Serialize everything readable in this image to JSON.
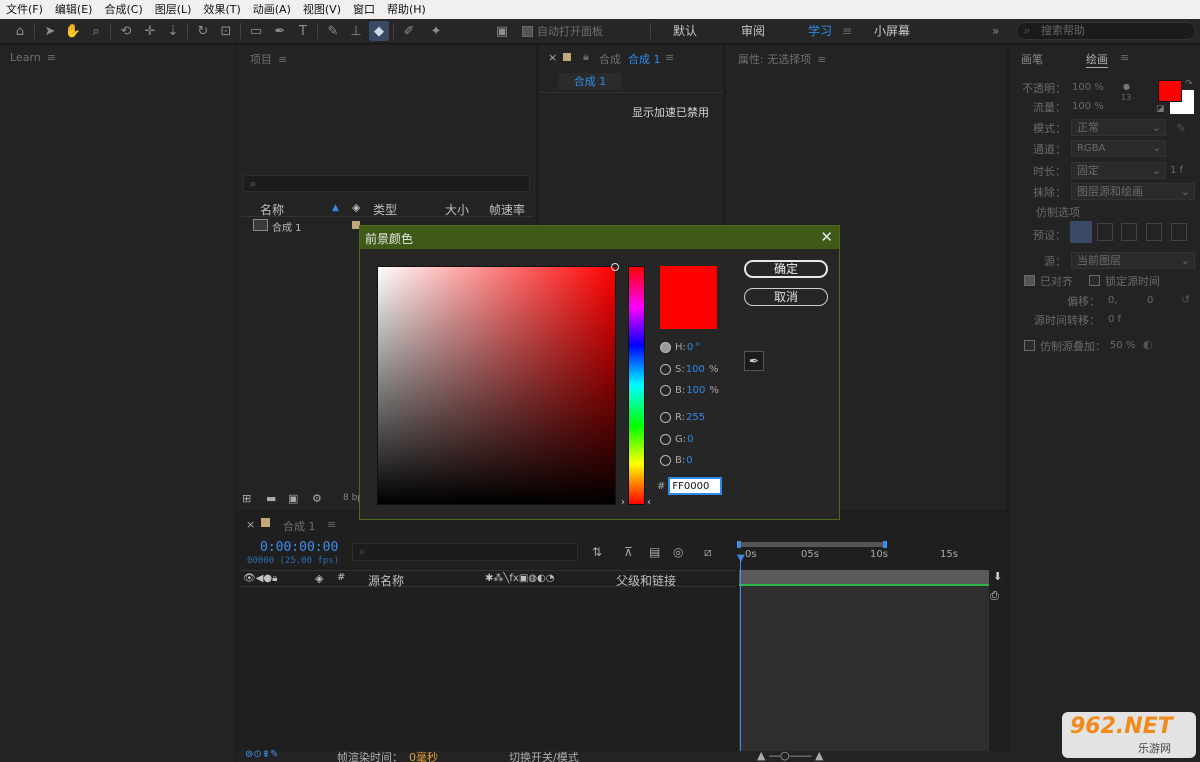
{
  "menu": [
    "文件(F)",
    "编辑(E)",
    "合成(C)",
    "图层(L)",
    "效果(T)",
    "动画(A)",
    "视图(V)",
    "窗口",
    "帮助(H)"
  ],
  "toolbar": {
    "auto_open": "自动打开面板",
    "workspaces": [
      "默认",
      "审阅",
      "学习",
      "小屏幕"
    ],
    "active_workspace": "学习",
    "overflow": "»",
    "search_placeholder": "搜索帮助"
  },
  "learn_panel": {
    "title": "Learn"
  },
  "project_panel": {
    "title": "项目",
    "search_icon": "⌕",
    "columns": [
      "名称",
      "类型",
      "大小",
      "帧速率"
    ],
    "item": {
      "name": "合成 1"
    },
    "bottom_bits": "8 bp"
  },
  "comp_panel": {
    "title": "合成",
    "comp_name": "合成 1",
    "tab_label": "合成 1",
    "message": "显示加速已禁用"
  },
  "properties_panel": {
    "title": "属性: 无选择项"
  },
  "paint_panel": {
    "tabs": [
      "画笔",
      "绘画"
    ],
    "opacity_label": "不透明：",
    "opacity_value": "100 %",
    "flow_label": "流量：",
    "flow_value": "100 %",
    "brush_size": "13",
    "mode_label": "模式：",
    "mode_value": "正常",
    "channels_label": "通道：",
    "channels_value": "RGBA",
    "duration_label": "时长：",
    "duration_value": "固定",
    "duration_frames": "1 f",
    "erase_label": "抹除：",
    "erase_value": "图层源和绘画",
    "clone_options": "仿制选项",
    "preset_label": "预设：",
    "source_label": "源：",
    "source_value": "当前图层",
    "aligned": "已对齐",
    "lock_source_time": "锁定源时间",
    "offset_label": "偏移：",
    "offset_x": "0,",
    "offset_y": "0",
    "source_time_shift_label": "源时间转移：",
    "source_time_shift_value": "0 f",
    "clone_overlay": "仿制源叠加：",
    "clone_overlay_value": "50 %",
    "foreground_color": "#ff0000",
    "background_color": "#ffffff"
  },
  "dialog": {
    "title": "前景颜色",
    "ok": "确定",
    "cancel": "取消",
    "h_label": "H:",
    "h_value": "0",
    "h_unit": "°",
    "s_label": "S:",
    "s_value": "100",
    "s_unit": "%",
    "b_label": "B:",
    "b_value": "100",
    "b_unit": "%",
    "r_label": "R:",
    "r_value": "255",
    "g_label": "G:",
    "g_value": "0",
    "bl_label": "B:",
    "bl_value": "0",
    "hash": "#",
    "hex": "FF0000",
    "color": "#ff0000"
  },
  "timeline": {
    "tab_label": "合成 1",
    "timecode": "0:00:00:00",
    "fps": "00000 (25.00 fps)",
    "col_hash": "#",
    "col_source": "源名称",
    "col_parent": "父级和链接",
    "ruler": [
      "0s",
      "05s",
      "10s",
      "15s"
    ],
    "render_time_label": "帧渲染时间：",
    "render_time_value": "0毫秒",
    "toggle_label": "切换开关/模式"
  },
  "watermark": {
    "text": "962.NET",
    "subtitle": "乐游网"
  }
}
